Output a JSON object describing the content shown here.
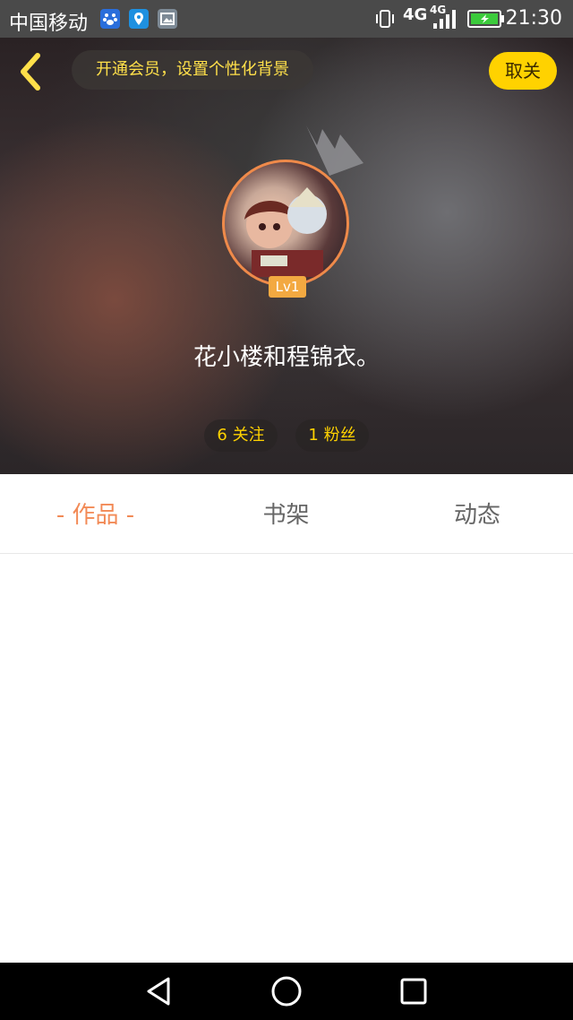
{
  "status_bar": {
    "carrier": "中国移动",
    "network_a": "4G",
    "network_b": "4G",
    "time": "21:30",
    "icons": [
      "baidu-paw-icon",
      "location-pin-icon",
      "gallery-icon",
      "vibrate-icon",
      "signal-icon",
      "battery-charging-icon"
    ]
  },
  "header": {
    "back_icon": "chevron-left-icon",
    "promo_text": "开通会员，设置个性化背景",
    "cancel_label": "取关",
    "level": "Lv1",
    "nickname": "花小楼和程锦衣。",
    "follow_text": "6 关注",
    "fans_text": "1 粉丝"
  },
  "tabs": [
    {
      "label": "- 作品 -",
      "active": true
    },
    {
      "label": "书架",
      "active": false
    },
    {
      "label": "动态",
      "active": false
    }
  ],
  "nav_bar": {
    "icons": [
      "back-triangle-icon",
      "home-circle-icon",
      "recents-square-icon"
    ]
  },
  "colors": {
    "accent": "#f28a56",
    "yellow": "#ffd200",
    "status_bg": "#4a4a4a"
  }
}
